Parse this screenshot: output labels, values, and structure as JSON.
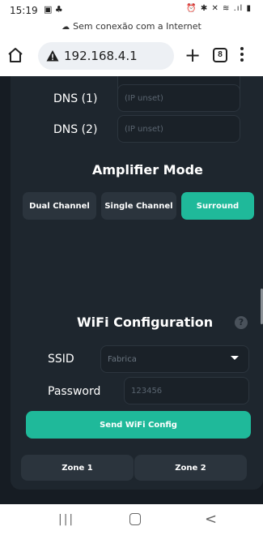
{
  "status_bar": {
    "time": "15:19",
    "left_icons": "▣ ♣",
    "right_icons": "⏰ ✱ ✕ ≋ .ıl ▮",
    "connection_text": "Sem conexão com a Internet"
  },
  "browser": {
    "url": "192.168.4.1",
    "tab_count": "8",
    "new_tab_label": "+"
  },
  "network": {
    "dns1_label": "DNS (1)",
    "dns1_placeholder": "(IP unset)",
    "dns2_label": "DNS (2)",
    "dns2_placeholder": "(IP unset)"
  },
  "amplifier": {
    "title": "Amplifier Mode",
    "modes": [
      "Dual Channel",
      "Single Channel",
      "Surround"
    ],
    "active_mode": "Surround"
  },
  "wifi": {
    "title": "WiFi Configuration",
    "help_label": "?",
    "ssid_label": "SSID",
    "ssid_value": "Fabrica",
    "password_label": "Password",
    "password_placeholder": "123456",
    "send_button": "Send WiFi Config"
  },
  "zones": [
    "Zone 1",
    "Zone 2"
  ],
  "nav": {
    "recent_label": "|||",
    "back_label": "<"
  },
  "colors": {
    "accent": "#1fb99a",
    "background": "#161c23",
    "panel": "#1e262e",
    "button": "#2b343d"
  }
}
